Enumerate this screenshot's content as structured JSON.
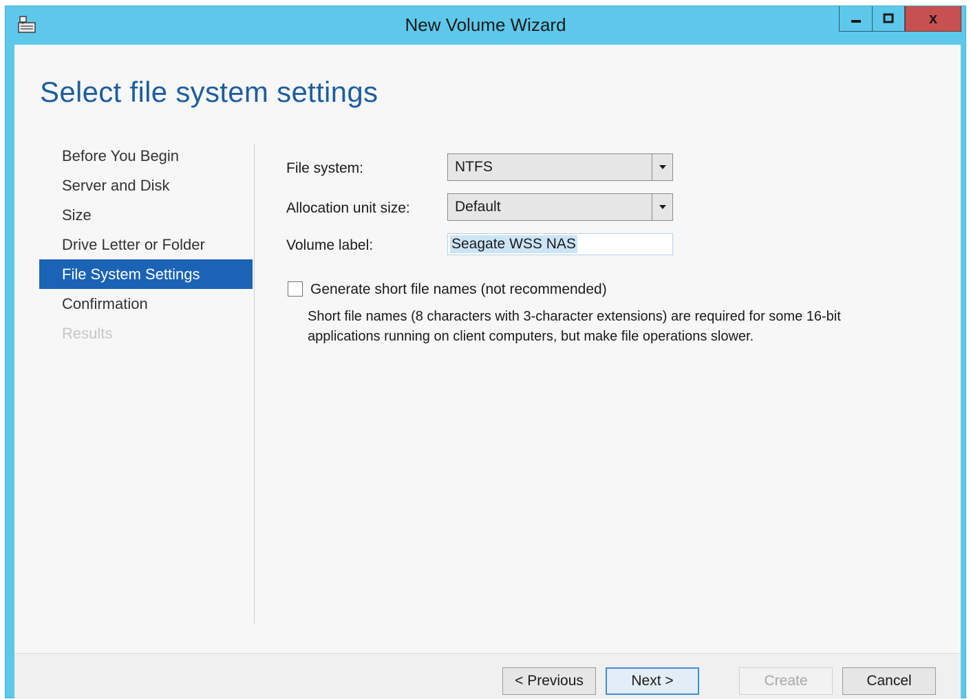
{
  "window": {
    "title": "New Volume Wizard",
    "app_icon": "disk-volume-icon",
    "controls": {
      "minimize_icon": "minimize-icon",
      "maximize_icon": "maximize-icon",
      "close_icon": "close-icon",
      "close_label": "x"
    }
  },
  "page": {
    "heading": "Select file system settings"
  },
  "nav": {
    "items": [
      {
        "label": "Before You Begin",
        "state": "normal"
      },
      {
        "label": "Server and Disk",
        "state": "normal"
      },
      {
        "label": "Size",
        "state": "normal"
      },
      {
        "label": "Drive Letter or Folder",
        "state": "normal"
      },
      {
        "label": "File System Settings",
        "state": "active"
      },
      {
        "label": "Confirmation",
        "state": "normal"
      },
      {
        "label": "Results",
        "state": "disabled"
      }
    ]
  },
  "form": {
    "file_system": {
      "label": "File system:",
      "value": "NTFS"
    },
    "allocation_unit": {
      "label": "Allocation unit size:",
      "value": "Default"
    },
    "volume_label": {
      "label": "Volume label:",
      "value": "Seagate WSS NAS"
    },
    "short_names": {
      "label": "Generate short file names (not recommended)",
      "checked": false,
      "description_line1": "Short file names (8 characters with 3-character extensions) are required for some 16-bit",
      "description_line2": "applications running on client computers, but make file operations slower."
    }
  },
  "footer": {
    "previous_label": "< Previous",
    "next_label": "Next >",
    "create_label": "Create",
    "cancel_label": "Cancel"
  },
  "colors": {
    "titlebar": "#5dc8ea",
    "heading": "#1e5e9c",
    "nav_active": "#1b63b5",
    "close_button": "#c75050"
  }
}
